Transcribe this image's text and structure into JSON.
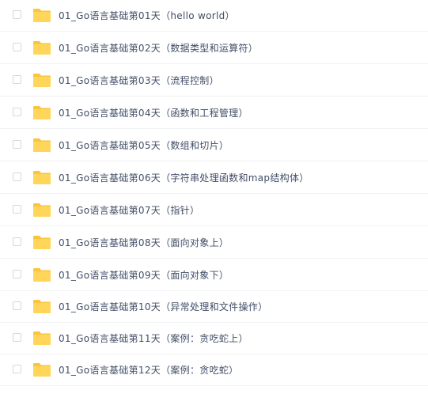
{
  "file_list": {
    "items": [
      {
        "name": "01_Go语言基础第01天（hello world）",
        "icon": "folder-icon",
        "checked": false
      },
      {
        "name": "01_Go语言基础第02天（数据类型和运算符）",
        "icon": "folder-icon",
        "checked": false
      },
      {
        "name": "01_Go语言基础第03天（流程控制）",
        "icon": "folder-icon",
        "checked": false
      },
      {
        "name": "01_Go语言基础第04天（函数和工程管理）",
        "icon": "folder-icon",
        "checked": false
      },
      {
        "name": "01_Go语言基础第05天（数组和切片）",
        "icon": "folder-icon",
        "checked": false
      },
      {
        "name": "01_Go语言基础第06天（字符串处理函数和map结构体）",
        "icon": "folder-icon",
        "checked": false
      },
      {
        "name": "01_Go语言基础第07天（指针）",
        "icon": "folder-icon",
        "checked": false
      },
      {
        "name": "01_Go语言基础第08天（面向对象上）",
        "icon": "folder-icon",
        "checked": false
      },
      {
        "name": "01_Go语言基础第09天（面向对象下）",
        "icon": "folder-icon",
        "checked": false
      },
      {
        "name": "01_Go语言基础第10天（异常处理和文件操作）",
        "icon": "folder-icon",
        "checked": false
      },
      {
        "name": "01_Go语言基础第11天（案例：贪吃蛇上）",
        "icon": "folder-icon",
        "checked": false
      },
      {
        "name": "01_Go语言基础第12天（案例：贪吃蛇）",
        "icon": "folder-icon",
        "checked": false
      }
    ]
  },
  "colors": {
    "folder_body": "#ffd659",
    "folder_back": "#f9c53d",
    "text": "#424e67",
    "divider": "#f1f2f4",
    "checkbox_border": "#d4d7dd"
  }
}
